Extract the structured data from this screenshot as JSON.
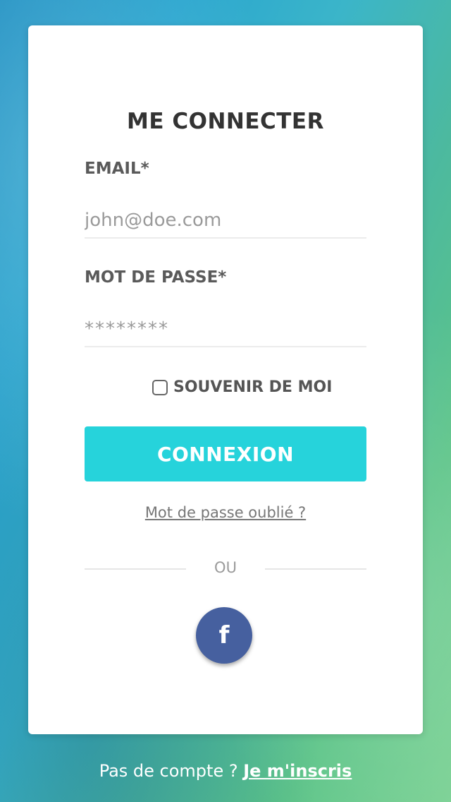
{
  "form": {
    "title": "ME CONNECTER",
    "email_label": "EMAIL*",
    "email_placeholder": "john@doe.com",
    "password_label": "MOT DE PASSE*",
    "password_placeholder": "********",
    "remember_label": "SOUVENIR DE MOI",
    "remember_checked": false,
    "submit_label": "CONNEXION",
    "forgot_label": "Mot de passe oublié ?",
    "divider_text": "OU",
    "facebook_glyph": "f",
    "facebook_icon": "facebook-icon"
  },
  "footer": {
    "prompt": "Pas de compte ?",
    "signup_label": "Je m'inscris"
  },
  "colors": {
    "accent": "#26d3db",
    "facebook": "#46609f",
    "title_text": "#333333",
    "label_text": "#5a5a5a"
  }
}
